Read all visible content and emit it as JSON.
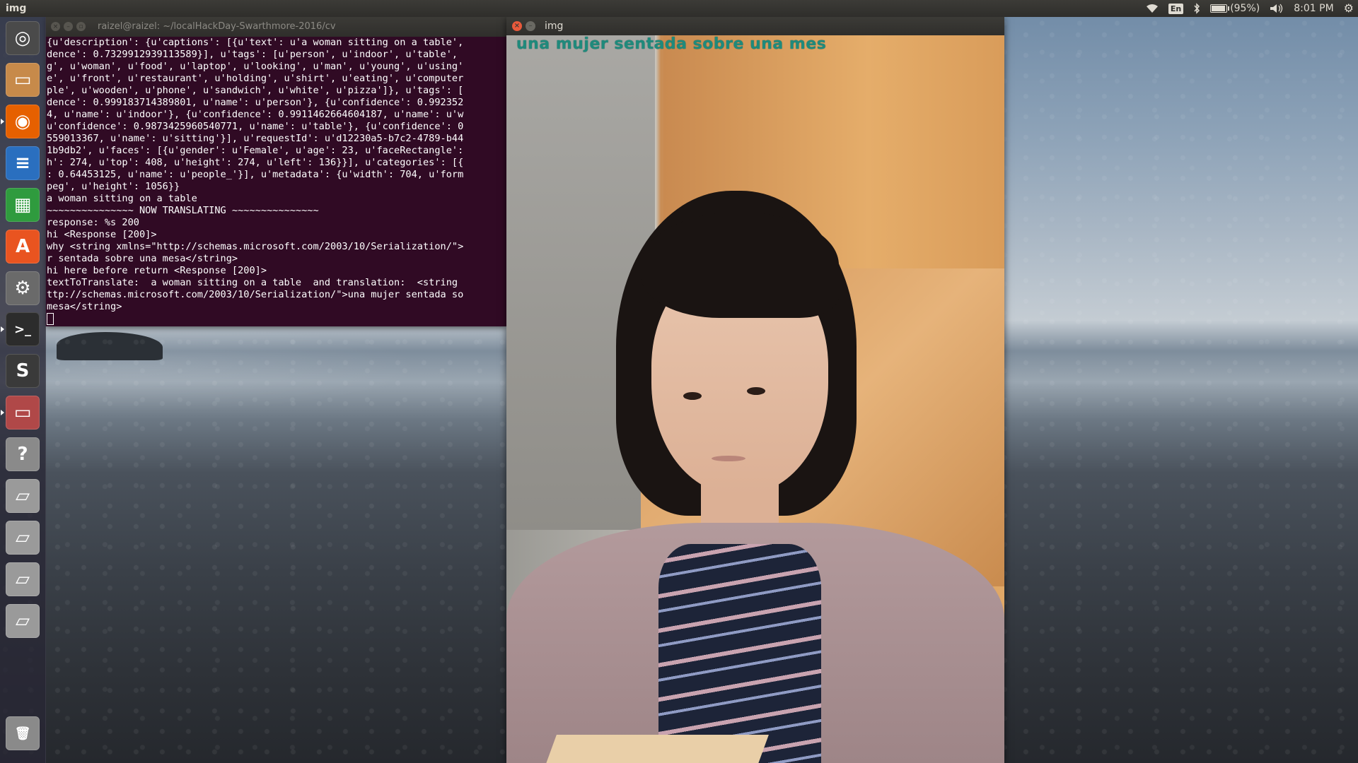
{
  "top_panel": {
    "app_title": "img",
    "keyboard_layout": "En",
    "battery_text": "(95%)",
    "battery_level": 0.95,
    "clock": "8:01 PM",
    "icons": [
      "wifi-icon",
      "bluetooth-icon",
      "battery-icon",
      "volume-icon",
      "settings-gear-icon"
    ]
  },
  "launcher": {
    "items": [
      {
        "name": "ubuntu-dash-icon",
        "glyph": "◎",
        "color": "#4a4a4a"
      },
      {
        "name": "files-icon",
        "glyph": "▭",
        "color": "#c78a4a"
      },
      {
        "name": "firefox-icon",
        "glyph": "◉",
        "color": "#e66000"
      },
      {
        "name": "libreoffice-writer-icon",
        "glyph": "≡",
        "color": "#2a6fbf"
      },
      {
        "name": "libreoffice-calc-icon",
        "glyph": "▦",
        "color": "#2f9b3e"
      },
      {
        "name": "ubuntu-software-icon",
        "glyph": "A",
        "color": "#e95420"
      },
      {
        "name": "system-settings-icon",
        "glyph": "⚙",
        "color": "#6a6a6a"
      },
      {
        "name": "terminal-icon",
        "glyph": ">_",
        "color": "#2c2c2c"
      },
      {
        "name": "sublime-text-icon",
        "glyph": "S",
        "color": "#3a3a3a"
      },
      {
        "name": "files-icon-2",
        "glyph": "▭",
        "color": "#b04848"
      },
      {
        "name": "help-icon",
        "glyph": "?",
        "color": "#8a8a8a"
      },
      {
        "name": "drive-icon-1",
        "glyph": "▱",
        "color": "#9a9a9a"
      },
      {
        "name": "drive-icon-2",
        "glyph": "▱",
        "color": "#9a9a9a"
      },
      {
        "name": "drive-icon-3",
        "glyph": "▱",
        "color": "#9a9a9a"
      },
      {
        "name": "drive-icon-4",
        "glyph": "▱",
        "color": "#9a9a9a"
      },
      {
        "name": "trash-icon",
        "glyph": "🗑",
        "color": "#8a8a8a"
      }
    ]
  },
  "terminal": {
    "title": "raizel@raizel: ~/localHackDay-Swarthmore-2016/cv",
    "lines": [
      "{u'description': {u'captions': [{u'text': u'a woman sitting on a table',",
      "dence': 0.7329912939113589}], u'tags': [u'person', u'indoor', u'table',",
      "g', u'woman', u'food', u'laptop', u'looking', u'man', u'young', u'using'",
      "e', u'front', u'restaurant', u'holding', u'shirt', u'eating', u'computer",
      "ple', u'wooden', u'phone', u'sandwich', u'white', u'pizza']}, u'tags': [",
      "dence': 0.999183714389801, u'name': u'person'}, {u'confidence': 0.992352",
      "4, u'name': u'indoor'}, {u'confidence': 0.9911462664604187, u'name': u'w",
      "u'confidence': 0.9873425960540771, u'name': u'table'}, {u'confidence': 0",
      "559013367, u'name': u'sitting'}], u'requestId': u'd12230a5-b7c2-4789-b44",
      "1b9db2', u'faces': [{u'gender': u'Female', u'age': 23, u'faceRectangle':",
      "h': 274, u'top': 408, u'height': 274, u'left': 136}}], u'categories': [{",
      ": 0.64453125, u'name': u'people_'}], u'metadata': {u'width': 704, u'form",
      "peg', u'height': 1056}}",
      "a woman sitting on a table",
      "~~~~~~~~~~~~~~~ NOW TRANSLATING ~~~~~~~~~~~~~~~",
      "response: %s 200",
      "hi <Response [200]>",
      "why <string xmlns=\"http://schemas.microsoft.com/2003/10/Serialization/\">",
      "r sentada sobre una mesa</string>",
      "hi here before return <Response [200]>",
      "textToTranslate:  a woman sitting on a table  and translation:  <string",
      "ttp://schemas.microsoft.com/2003/10/Serialization/\">una mujer sentada so",
      "mesa</string>"
    ]
  },
  "image_window": {
    "title": "img",
    "caption_overlay": "una mujer sentada sobre una mes"
  }
}
